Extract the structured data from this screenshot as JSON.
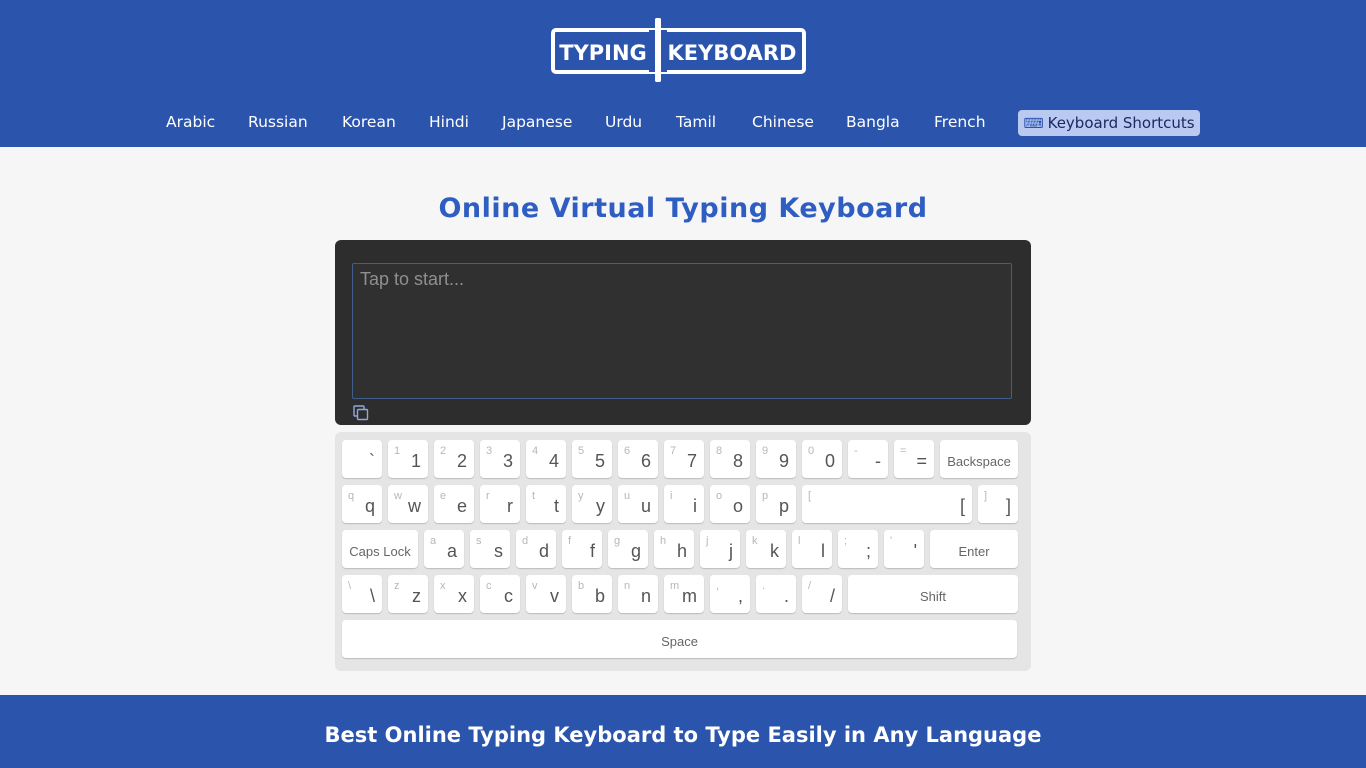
{
  "logo": {
    "left": "TYPING",
    "right": "KEYBOARD"
  },
  "nav": {
    "items": [
      "Arabic",
      "Russian",
      "Korean",
      "Hindi",
      "Japanese",
      "Urdu",
      "Tamil",
      "Chinese",
      "Bangla",
      "French"
    ],
    "shortcuts_label": "Keyboard Shortcuts",
    "shortcuts_icon": "⌨"
  },
  "page_title": "Online Virtual Typing Keyboard",
  "editor": {
    "placeholder": "Tap to start...",
    "value": ""
  },
  "keyboard": {
    "row1": [
      {
        "main": "`",
        "sub": ""
      },
      {
        "main": "1",
        "sub": "1"
      },
      {
        "main": "2",
        "sub": "2"
      },
      {
        "main": "3",
        "sub": "3"
      },
      {
        "main": "4",
        "sub": "4"
      },
      {
        "main": "5",
        "sub": "5"
      },
      {
        "main": "6",
        "sub": "6"
      },
      {
        "main": "7",
        "sub": "7"
      },
      {
        "main": "8",
        "sub": "8"
      },
      {
        "main": "9",
        "sub": "9"
      },
      {
        "main": "0",
        "sub": "0"
      },
      {
        "main": "-",
        "sub": "-"
      },
      {
        "main": "=",
        "sub": "="
      }
    ],
    "backspace": "Backspace",
    "row2": [
      {
        "main": "q",
        "sub": "q"
      },
      {
        "main": "w",
        "sub": "w"
      },
      {
        "main": "e",
        "sub": "e"
      },
      {
        "main": "r",
        "sub": "r"
      },
      {
        "main": "t",
        "sub": "t"
      },
      {
        "main": "y",
        "sub": "y"
      },
      {
        "main": "u",
        "sub": "u"
      },
      {
        "main": "i",
        "sub": "i"
      },
      {
        "main": "o",
        "sub": "o"
      },
      {
        "main": "p",
        "sub": "p"
      },
      {
        "main": "[",
        "sub": "["
      },
      {
        "main": "]",
        "sub": "]"
      }
    ],
    "caps_lock": "Caps Lock",
    "row3": [
      {
        "main": "a",
        "sub": "a"
      },
      {
        "main": "s",
        "sub": "s"
      },
      {
        "main": "d",
        "sub": "d"
      },
      {
        "main": "f",
        "sub": "f"
      },
      {
        "main": "g",
        "sub": "g"
      },
      {
        "main": "h",
        "sub": "h"
      },
      {
        "main": "j",
        "sub": "j"
      },
      {
        "main": "k",
        "sub": "k"
      },
      {
        "main": "l",
        "sub": "l"
      },
      {
        "main": ";",
        "sub": ";"
      },
      {
        "main": "'",
        "sub": "'"
      }
    ],
    "enter": "Enter",
    "row4": [
      {
        "main": "\\",
        "sub": "\\"
      },
      {
        "main": "z",
        "sub": "z"
      },
      {
        "main": "x",
        "sub": "x"
      },
      {
        "main": "c",
        "sub": "c"
      },
      {
        "main": "v",
        "sub": "v"
      },
      {
        "main": "b",
        "sub": "b"
      },
      {
        "main": "n",
        "sub": "n"
      },
      {
        "main": "m",
        "sub": "m"
      },
      {
        "main": ",",
        "sub": ","
      },
      {
        "main": ".",
        "sub": "."
      },
      {
        "main": "/",
        "sub": "/"
      }
    ],
    "shift": "Shift",
    "space": "Space"
  },
  "footer_title": "Best Online Typing Keyboard to Type Easily in Any Language",
  "colors": {
    "brand": "#2b54ad",
    "title": "#2f5ec2",
    "editor_bg": "#2d2d2d",
    "shortcut_bg": "#b9c9f2"
  }
}
